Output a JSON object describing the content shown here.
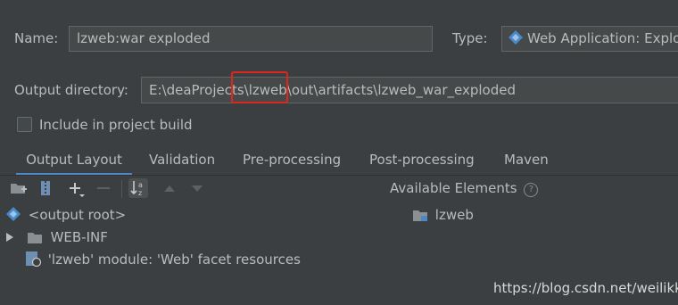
{
  "name_label": "Name:",
  "name_value": "lzweb:war exploded",
  "type_label": "Type:",
  "type_value": "Web Application: Exploded",
  "output_dir_label": "Output directory:",
  "output_dir_value": "E:\\deaProjects\\lzweb\\out\\artifacts\\lzweb_war_exploded",
  "include_label": "Include in project build",
  "tabs": [
    "Output Layout",
    "Validation",
    "Pre-processing",
    "Post-processing",
    "Maven"
  ],
  "tree": {
    "root": "<output root>",
    "webinf": "WEB-INF",
    "facet": "'lzweb' module: 'Web' facet resources"
  },
  "available_title": "Available Elements",
  "available_items": [
    "lzweb"
  ],
  "watermark": "https://blog.csdn.net/weilikk",
  "colors": {
    "accent": "#4a88c7",
    "highlight_box": "#e0261b"
  }
}
